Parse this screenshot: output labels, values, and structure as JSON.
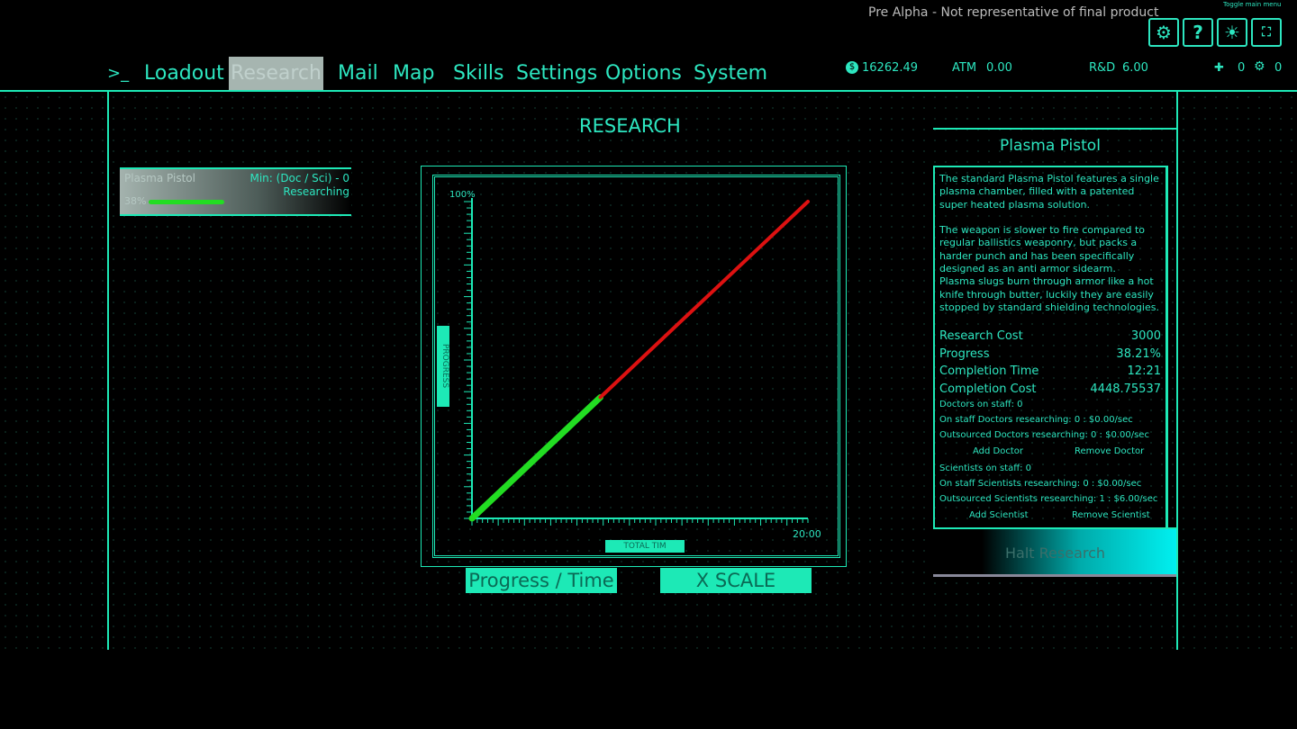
{
  "header": {
    "notice": "Pre Alpha - Not representative of final product",
    "toggle_menu": "Toggle main menu",
    "icons": [
      "gear-icon",
      "help-icon",
      "bug-icon",
      "fullscreen-icon"
    ],
    "money": "16262.49",
    "atm_label": "ATM",
    "atm_value": "0.00",
    "rd_label": "R&D",
    "rd_value": "6.00",
    "doctors": "0",
    "scientists": "0"
  },
  "nav": {
    "prompt": ">_",
    "items": [
      "Loadout",
      "Research",
      "Mail",
      "Map",
      "Skills",
      "Settings",
      "Options",
      "System"
    ],
    "active": "Research"
  },
  "page_title": "RESEARCH",
  "research_list": [
    {
      "name": "Plasma Pistol",
      "min": "Min: (Doc / Sci) - 0",
      "status": "Researching",
      "percent": "38%",
      "progress": 38.21
    }
  ],
  "detail": {
    "title": "Plasma Pistol",
    "description_1": "The standard Plasma Pistol features a single plasma chamber, filled with a patented super heated plasma solution.",
    "description_2": "The weapon is slower to fire compared to regular ballistics weaponry, but packs a harder punch and has been specifically designed as an anti armor sidearm.",
    "description_3": "Plasma slugs burn through armor like a hot knife through butter, luckily they are easily stopped by standard shielding technologies.",
    "stats": [
      {
        "label": "Research Cost",
        "value": "3000"
      },
      {
        "label": "Progress",
        "value": "38.21%"
      },
      {
        "label": "Completion Time",
        "value": "12:21"
      },
      {
        "label": "Completion Cost",
        "value": "4448.75537"
      }
    ],
    "doctors_on_staff": "Doctors on staff: 0",
    "onstaff_doctors": "On staff Doctors researching: 0 : $0.00/sec",
    "outsourced_doctors": "Outsourced Doctors researching: 0 : $0.00/sec",
    "add_doctor": "Add Doctor",
    "remove_doctor": "Remove Doctor",
    "scientists_on_staff": "Scientists on staff: 0",
    "onstaff_scientists": "On staff Scientists researching: 0 : $0.00/sec",
    "outsourced_scientists": "Outsourced Scientists researching: 1 : $6.00/sec",
    "add_scientist": "Add Scientist",
    "remove_scientist": "Remove Scientist",
    "halt": "Halt Research"
  },
  "chart_buttons": {
    "progress_time": "Progress / Time",
    "x_scale": "X SCALE"
  },
  "chart_data": {
    "type": "line",
    "ylabel": "PROGRESS",
    "xlabel": "TOTAL TIM",
    "y_tick_label": "100%",
    "x_tick_label": "20:00",
    "xlim": [
      0,
      20
    ],
    "ylim": [
      0,
      100
    ],
    "series": [
      {
        "color": "#22dd22",
        "points": [
          [
            0,
            0
          ],
          [
            7.64,
            38.21
          ]
        ]
      },
      {
        "color": "#dd1111",
        "points": [
          [
            7.64,
            38.21
          ],
          [
            20,
            100
          ]
        ]
      }
    ]
  }
}
